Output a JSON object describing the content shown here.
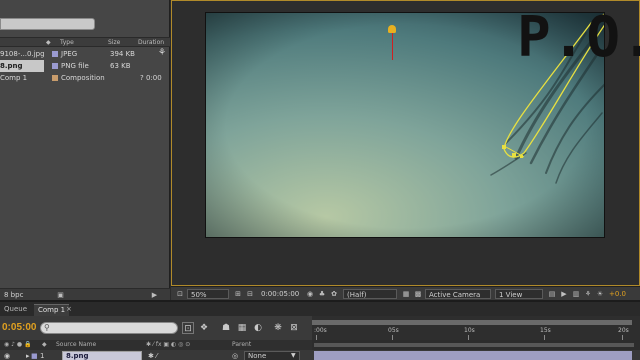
{
  "project": {
    "columns": {
      "type": "Type",
      "size": "Size",
      "duration": "Duration"
    },
    "items": [
      {
        "name": "9108-...0.jpg",
        "type": "JPEG",
        "size": "394 KB",
        "duration": "",
        "color": "#9a9ad0"
      },
      {
        "name": "8.png",
        "type": "PNG file",
        "size": "63 KB",
        "duration": "",
        "color": "#9a9ad0"
      },
      {
        "name": "Comp 1",
        "type": "Composition",
        "size": "",
        "duration": "? 0:00",
        "color": "#c89c6c"
      }
    ],
    "bpc": "8 bpc"
  },
  "viewer": {
    "overlay_text": "P.O.",
    "toolbar": {
      "zoom": "50%",
      "timecode": "0:00:05:00",
      "resolution": "(Half)",
      "camera": "Active Camera",
      "view": "1 View",
      "exposure": "+0.0"
    }
  },
  "timeline": {
    "tabs": [
      "Queue",
      "Comp 1"
    ],
    "timecode": "0:05:00",
    "ruler_labels": [
      ":00s",
      "05s",
      "10s",
      "15s",
      "20s"
    ],
    "columns": {
      "source_name": "Source Name",
      "parent": "Parent"
    },
    "layer": {
      "number": "1",
      "name": "8.png",
      "parent": "None"
    }
  }
}
